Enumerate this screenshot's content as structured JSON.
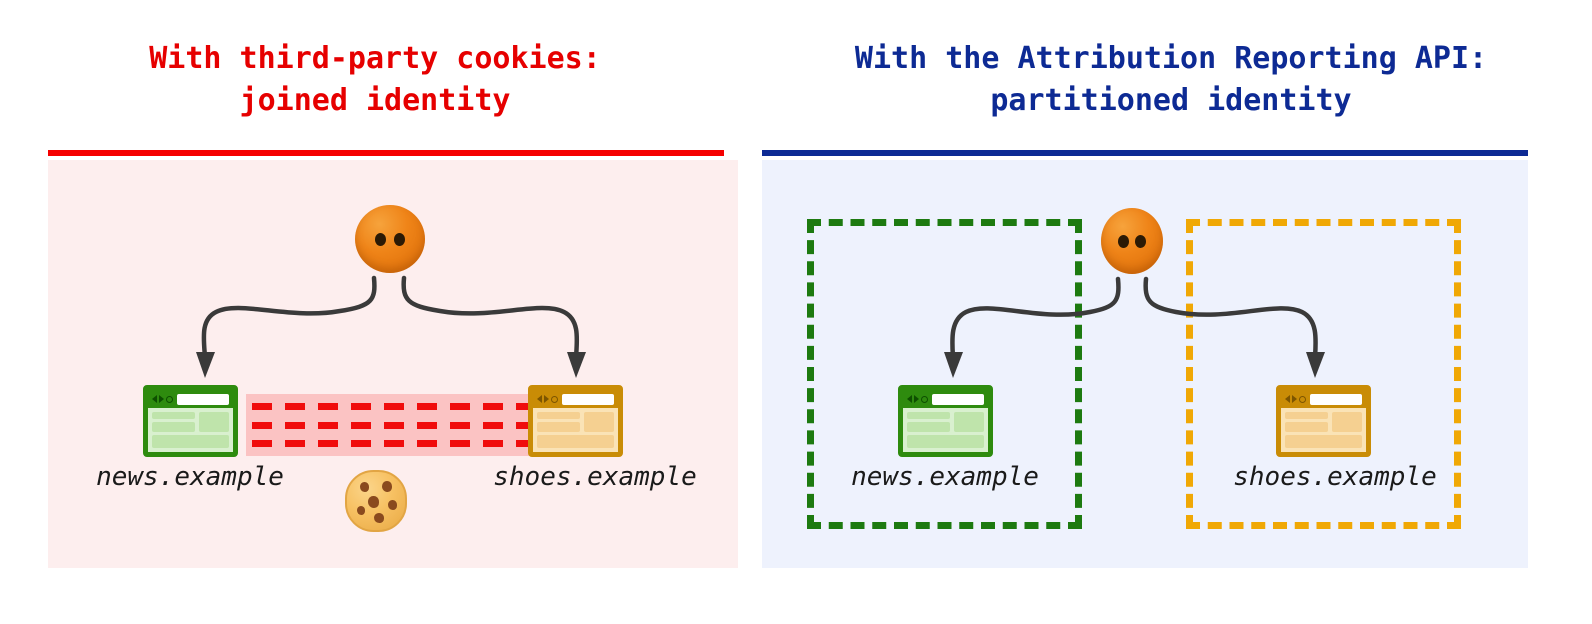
{
  "panels": [
    {
      "id": "third-party-cookies",
      "title_line1": "With third-party cookies:",
      "title_line2": "joined identity",
      "accent_color": "#e60000",
      "rule_color": "#f50000",
      "background_color": "#fdeeee",
      "sites": [
        {
          "id": "news",
          "label": "news.example",
          "skin": "green",
          "border_color": "#2e8b0e"
        },
        {
          "id": "shoes",
          "label": "shoes.example",
          "skin": "amber",
          "border_color": "#c98c06"
        }
      ],
      "identity_face": {
        "name": "user-identity-face",
        "color": "#ef8418"
      },
      "cookie": {
        "name": "third-party-cookie",
        "color": "#f7c163"
      },
      "shared_band": {
        "name": "shared-identity-band",
        "fill": "#fbc3c3",
        "dash_color": "#f00c0c",
        "rows": 3
      },
      "partitions": []
    },
    {
      "id": "attribution-reporting-api",
      "title_line1": "With the Attribution Reporting API:",
      "title_line2": "partitioned identity",
      "accent_color": "#0d2a94",
      "rule_color": "#0d2a94",
      "background_color": "#eef2fd",
      "sites": [
        {
          "id": "news",
          "label": "news.example",
          "skin": "green",
          "border_color": "#2e8b0e"
        },
        {
          "id": "shoes",
          "label": "shoes.example",
          "skin": "amber",
          "border_color": "#c98c06"
        }
      ],
      "identity_face": {
        "name": "user-identity-face",
        "color": "#ef8418"
      },
      "cookie": null,
      "shared_band": null,
      "partitions": [
        {
          "id": "news-partition",
          "border_color": "#1d7a10",
          "style": "dashed"
        },
        {
          "id": "shoes-partition",
          "border_color": "#f0a805",
          "style": "dashed"
        }
      ]
    }
  ],
  "icons": {
    "browser_window": "browser-window-icon",
    "cookie": "cookie-icon",
    "face": "face-icon",
    "arrow": "curved-arrow-icon"
  }
}
